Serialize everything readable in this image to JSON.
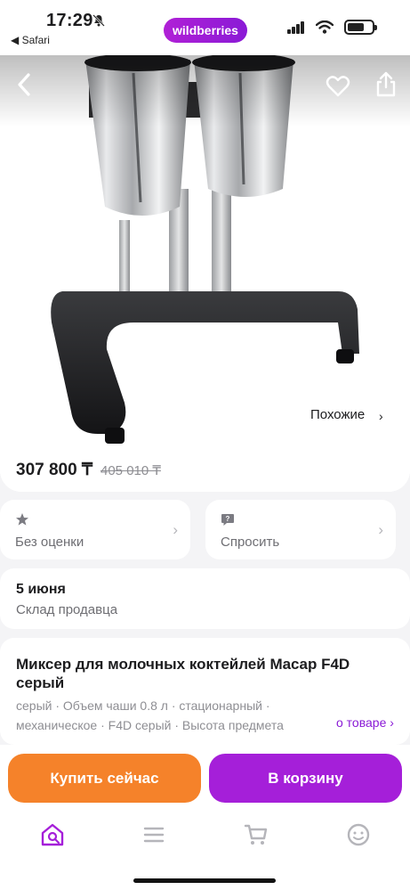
{
  "status_bar": {
    "time": "17:29",
    "back_app": "◀ Safari",
    "brand": "wildberries"
  },
  "hero": {
    "similar_label": "Похожие",
    "similar_chevron": "›"
  },
  "price": {
    "current": "307 800 ₸",
    "old": "405 010 ₸"
  },
  "rating_card": {
    "label": "Без оценки",
    "icon": "star-icon"
  },
  "ask_card": {
    "label": "Спросить",
    "icon": "question-bubble-icon"
  },
  "delivery": {
    "date": "5 июня",
    "source": "Склад продавца"
  },
  "product": {
    "title": "Миксер для молочных коктейлей Macap F4D серый",
    "tags_line1": "серый · Объем чаши 0.8 л · стационарный ·",
    "tags_line2": "механическое · F4D серый · Высота предмета",
    "more_label": "о товаре ›"
  },
  "actions": {
    "buy_now": "Купить сейчас",
    "to_cart": "В корзину"
  },
  "tabbar": {
    "items": [
      "home-search-icon",
      "menu-icon",
      "cart-icon",
      "profile-icon"
    ],
    "active_color": "#a51fd9",
    "inactive_color": "#b5b5ba"
  },
  "colors": {
    "accent_purple": "#a51fd9",
    "accent_orange": "#f5822a"
  }
}
